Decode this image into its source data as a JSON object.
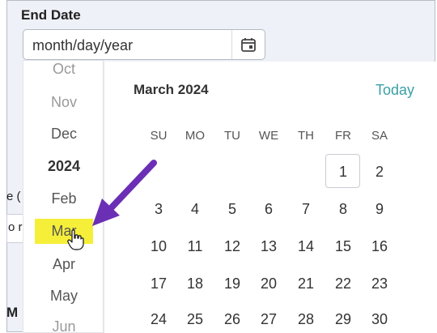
{
  "field": {
    "label": "End Date",
    "value": "month/day/year"
  },
  "background": {
    "fragment_1": "e (",
    "fragment_2": "o r",
    "fragment_3": "M"
  },
  "month_list": {
    "items": [
      "Oct",
      "Nov",
      "Dec",
      "2024",
      "Feb",
      "Mar",
      "Apr",
      "May",
      "Jun"
    ]
  },
  "calendar": {
    "title": "March 2024",
    "today_label": "Today",
    "weekdays": [
      "SU",
      "MO",
      "TU",
      "WE",
      "TH",
      "FR",
      "SA"
    ],
    "days": [
      "1",
      "2",
      "3",
      "4",
      "5",
      "6",
      "7",
      "8",
      "9",
      "10",
      "11",
      "12",
      "13",
      "14",
      "15",
      "16",
      "17",
      "18",
      "19",
      "20",
      "21",
      "22",
      "23",
      "24",
      "25",
      "26",
      "27",
      "28",
      "29",
      "30"
    ]
  },
  "colors": {
    "highlight": "#f6ef39",
    "arrow": "#6b2fb5",
    "today_link": "#3aa0a6"
  },
  "icons": {
    "calendar": "calendar-icon",
    "cursor": "hand-pointer-icon",
    "annotation": "arrow-annotation"
  }
}
